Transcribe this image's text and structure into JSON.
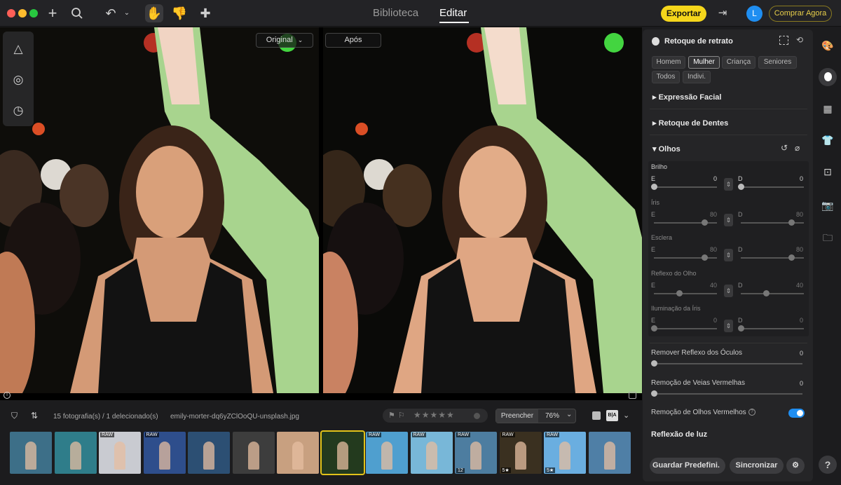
{
  "topbar": {
    "mode_tabs": {
      "library": "Biblioteca",
      "edit": "Editar"
    },
    "export_label": "Exportar",
    "avatar_initial": "L",
    "buy_label": "Comprar Agora"
  },
  "viewer": {
    "before_label": "Original",
    "after_label": "Após"
  },
  "filmstrip": {
    "count_text": "15 fotografia(s) / 1 delecionado(s)",
    "filename": "emily-morter-dq6yZClOoQU-unsplash.jpg",
    "fill_label": "Preencher",
    "zoom_label": "76%",
    "compare_icon_label": "B|A",
    "thumbnails": [
      {
        "tag": "",
        "badge": "",
        "color": "#3d6f88"
      },
      {
        "tag": "",
        "badge": "",
        "color": "#2f7d8a"
      },
      {
        "tag": "RAW",
        "badge": "",
        "color": "#c9cbd1"
      },
      {
        "tag": "RAW",
        "badge": "",
        "color": "#2e4e8c"
      },
      {
        "tag": "",
        "badge": "",
        "color": "#2c4f73"
      },
      {
        "tag": "",
        "badge": "",
        "color": "#3d3d3d"
      },
      {
        "tag": "",
        "badge": "",
        "color": "#c8a080"
      },
      {
        "tag": "",
        "badge": "",
        "color": "#233a1e"
      },
      {
        "tag": "RAW",
        "badge": "",
        "color": "#4f9fcf"
      },
      {
        "tag": "RAW",
        "badge": "",
        "color": "#78b7d8"
      },
      {
        "tag": "RAW",
        "badge": "12",
        "color": "#4d7da0"
      },
      {
        "tag": "RAW",
        "badge": "5★",
        "color": "#3a3020"
      },
      {
        "tag": "RAW",
        "badge": "5★",
        "color": "#6aaee0"
      },
      {
        "tag": "",
        "badge": "",
        "color": "#4f7fa6"
      }
    ]
  },
  "panel": {
    "title": "Retoque de retrato",
    "chips": [
      "Homem",
      "Mulher",
      "Criança",
      "Seniores",
      "Todos",
      "Indivi."
    ],
    "active_chip": "Mulher",
    "sections": {
      "facial": "Expressão Facial",
      "teeth": "Retoque de Dentes",
      "eyes": "Olhos"
    },
    "eyes": {
      "brilho": {
        "label": "Brilho",
        "left_label": "E",
        "left_value": "0",
        "right_label": "D",
        "right_value": "0"
      },
      "iris": {
        "label": "Íris",
        "left_label": "E",
        "left_value": "80",
        "right_label": "D",
        "right_value": "80"
      },
      "esclera": {
        "label": "Esclera",
        "left_label": "E",
        "left_value": "80",
        "right_label": "D",
        "right_value": "80"
      },
      "reflexo": {
        "label": "Reflexo do Olho",
        "left_label": "E",
        "left_value": "40",
        "right_label": "D",
        "right_value": "40"
      },
      "iluminacao": {
        "label": "Iluminação da Íris",
        "left_label": "E",
        "left_value": "0",
        "right_label": "D",
        "right_value": "0"
      }
    },
    "glasses_reflection": {
      "label": "Remover Reflexo dos Óculos",
      "value": "0"
    },
    "red_veins": {
      "label": "Remoção de Veias Vermelhas",
      "value": "0"
    },
    "red_eye": {
      "label": "Remoção de Olhos Vermelhos",
      "enabled": true
    },
    "light_reflection": "Reflexão de luz",
    "save_preset": "Guardar Predefini.",
    "sync": "Sincronizar"
  },
  "help_label": "?",
  "colors": {
    "accent": "#f5d61b",
    "toggle": "#1f8ef1",
    "selected_thumb": "#e2c21a"
  }
}
